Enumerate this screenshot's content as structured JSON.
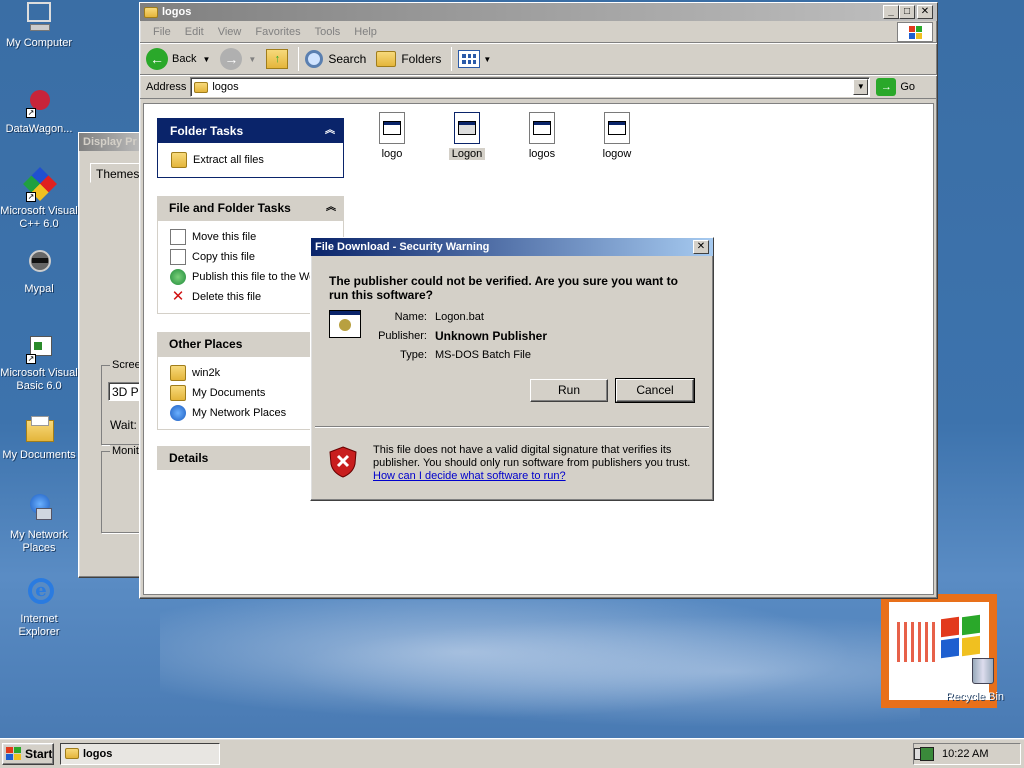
{
  "desktop": {
    "icons": [
      {
        "label": "My Computer"
      },
      {
        "label": "DataWagon..."
      },
      {
        "label": "Microsoft Visual C++ 6.0"
      },
      {
        "label": "Mypal"
      },
      {
        "label": "Microsoft Visual Basic 6.0"
      },
      {
        "label": "My Documents"
      },
      {
        "label": "My Network Places"
      },
      {
        "label": "Internet Explorer"
      },
      {
        "label": "Recycle Bin"
      }
    ]
  },
  "display_window": {
    "title": "Display Pr",
    "tab": "Themes",
    "screen_group": "Scree",
    "screen_value": "3D P",
    "wait_label": "Wait:",
    "monitor_group": "Monito"
  },
  "explorer": {
    "title": "logos",
    "menu": [
      "File",
      "Edit",
      "View",
      "Favorites",
      "Tools",
      "Help"
    ],
    "toolbar": {
      "back": "Back",
      "search": "Search",
      "folders": "Folders"
    },
    "address_label": "Address",
    "address_value": "logos",
    "go_label": "Go",
    "folder_tasks": {
      "title": "Folder Tasks",
      "items": [
        "Extract all files"
      ]
    },
    "file_tasks": {
      "title": "File and Folder Tasks",
      "items": [
        "Move this file",
        "Copy this file",
        "Publish this file to the Web",
        "Delete this file"
      ]
    },
    "other_places": {
      "title": "Other Places",
      "items": [
        "win2k",
        "My Documents",
        "My Network Places"
      ]
    },
    "details": {
      "title": "Details"
    },
    "files": [
      "logo",
      "Logon",
      "logos",
      "logow"
    ]
  },
  "dialog": {
    "title": "File Download - Security Warning",
    "question": "The publisher could not be verified.  Are you sure you want to run this software?",
    "name_label": "Name:",
    "name_value": "Logon.bat",
    "publisher_label": "Publisher:",
    "publisher_value": "Unknown Publisher",
    "type_label": "Type:",
    "type_value": "MS-DOS Batch File",
    "run_label": "Run",
    "cancel_label": "Cancel",
    "warning_text": "This file does not have a valid digital signature that verifies its publisher.  You should only run software from publishers you trust.",
    "help_link": "How can I decide what software to run?"
  },
  "taskbar": {
    "start_label": "Start",
    "task_label": "logos",
    "clock": "10:22 AM"
  }
}
